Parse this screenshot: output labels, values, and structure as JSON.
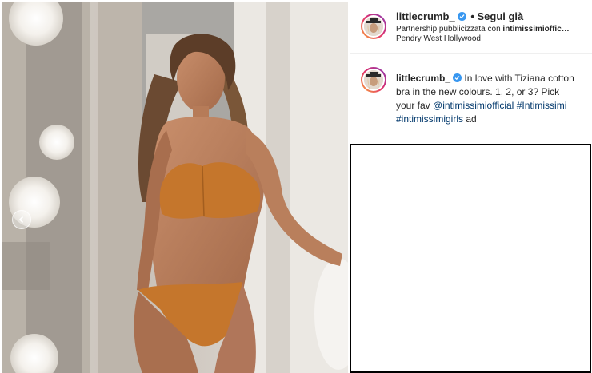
{
  "header": {
    "username": "littlecrumb_",
    "follow_label": "• Segui già",
    "partnership_prefix": "Partnership pubblicizzata con",
    "partnership_brand": "intimissimioffic…",
    "location": "Pendry West Hollywood"
  },
  "caption": {
    "username": "littlecrumb_",
    "text": "In love with Tiziana cotton bra in the new colours. 1, 2, or 3? Pick your fav",
    "tags": [
      "@intimissimiofficial",
      "#Intimissimi",
      "#intimissimigirls"
    ],
    "suffix": "ad"
  },
  "colors": {
    "verified": "#3897f0",
    "link": "#00376b",
    "bra": "#c5762c"
  }
}
